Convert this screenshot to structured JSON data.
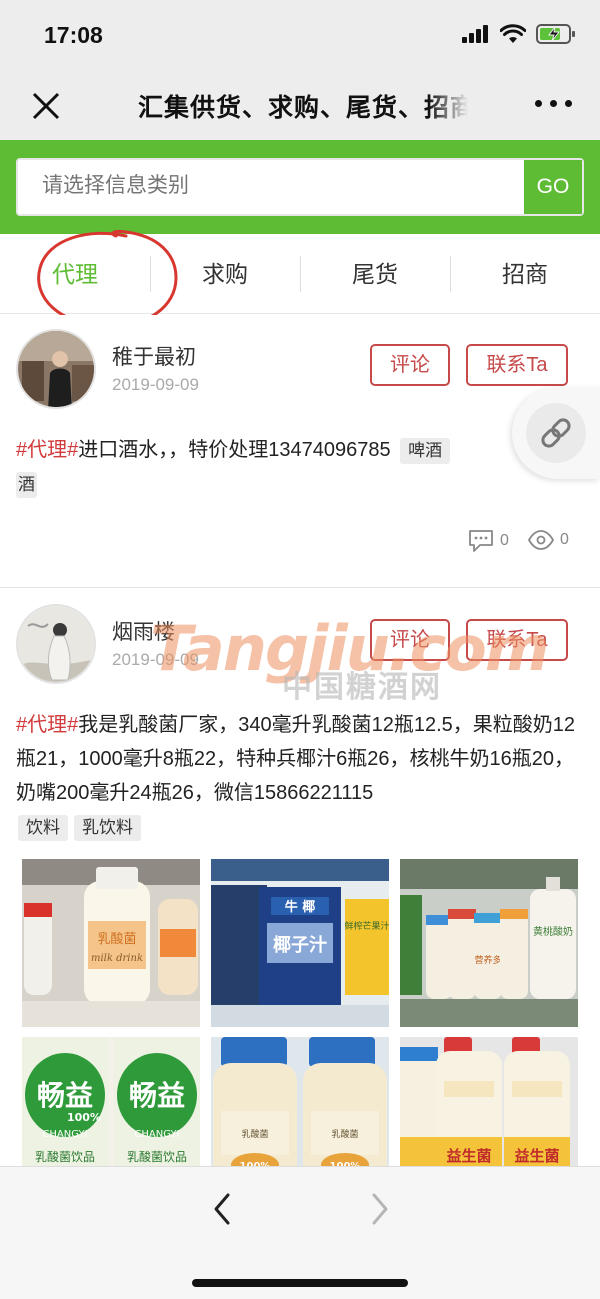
{
  "status_bar": {
    "time": "17:08"
  },
  "nav": {
    "title": "汇集供货、求购、尾货、招商"
  },
  "search": {
    "placeholder": "请选择信息类别",
    "go_label": "GO"
  },
  "tabs": [
    {
      "label": "代理",
      "active": true
    },
    {
      "label": "求购",
      "active": false
    },
    {
      "label": "尾货",
      "active": false
    },
    {
      "label": "招商",
      "active": false
    }
  ],
  "accent_color": "#5ebc34",
  "link_color": "#c64a4a",
  "posts": [
    {
      "username": "稚于最初",
      "date": "2019-09-09",
      "comment_label": "评论",
      "contact_label": "联系Ta",
      "hashtag": "#代理#",
      "body": "进口酒水，，特价处理13474096785",
      "tags": [
        "啤酒",
        "酒"
      ],
      "comments": "0",
      "views": "0"
    },
    {
      "username": "烟雨楼",
      "date": "2019-09-09",
      "comment_label": "评论",
      "contact_label": "联系Ta",
      "hashtag": "#代理#",
      "body": "我是乳酸菌厂家，340毫升乳酸菌12瓶12.5，果粒酸奶12瓶21，1000毫升8瓶22，特种兵椰汁6瓶26，核桃牛奶16瓶20，奶嘴200毫升24瓶26，微信15866221115",
      "tags": [
        "饮料",
        "乳饮料"
      ],
      "images": [
        {
          "label_top": "乳酸菌",
          "label_mid": "milk drink"
        },
        {
          "label_top": "牛 椰",
          "label_mid": "椰子汁",
          "label_side": "鲜榨芒果汁"
        },
        {
          "label_top": "黄桃酸奶",
          "label_mid": "营养多"
        },
        {
          "label_top": "畅益",
          "label_mid": "100%",
          "label_side": "CHANGYI",
          "label_bottom": "乳酸菌饮品"
        },
        {
          "label_top": "100%",
          "label_mid": "乳酸菌"
        },
        {
          "label_top": "益生菌",
          "label_mid": "益生菌"
        }
      ]
    }
  ],
  "watermark": {
    "latin": "Tangjiu.com",
    "chinese": "中国糖酒网"
  }
}
